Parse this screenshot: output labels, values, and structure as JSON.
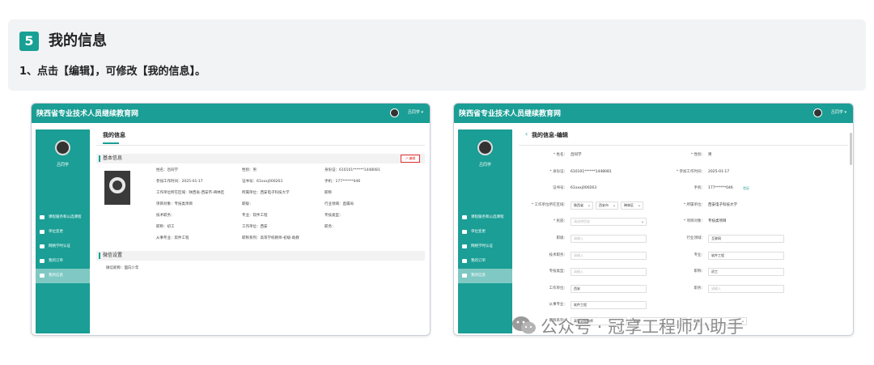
{
  "guide": {
    "step_number": "5",
    "step_title": "我的信息",
    "instruction": "1、点击【编辑】，可修改【我的信息】。"
  },
  "left_shot": {
    "site_title": "陕西省专业技术人员继续教育网",
    "user_name": "吕同学",
    "sidebar_user": "吕同学",
    "nav": [
      "课程服务和公选课程",
      "单位变更",
      "网络学时认证",
      "我的订单",
      "我的信息"
    ],
    "page_title": "我的信息",
    "section_basic": "基本信息",
    "edit_button": "编辑",
    "fields": {
      "name": "姓名：吕同学",
      "gender": "性别：男",
      "idcard": "身份证：610101******1448081",
      "workdate": "参加工作时间：2025-01-17",
      "cert": "证书号：61xxxj000263",
      "phone": "手机：177******046",
      "region": "工作单位所在区域：陕西省-西安市-碑林区",
      "unit": "所属单位：西安电子科技大学",
      "rank": "职称",
      "project": "项目对象：专技类项目",
      "post": "职级：",
      "industry": "行业领域：直属局",
      "tech_post": "技术职务：",
      "major": "专业：软件工程",
      "major_type": "专技类型：",
      "level": "职称：初工",
      "work_unit": "工作单位：西安",
      "duty": "职务：",
      "prof": "从事专业：软件工程",
      "series": "职称系列：高等学校教师-初级-助教"
    },
    "section_wx": "微信设置",
    "wx_label": "微信昵称：面向少年"
  },
  "right_shot": {
    "site_title": "陕西省专业技术人员继续教育网",
    "user_name": "吕同学",
    "sidebar_user": "吕同学",
    "nav": [
      "课程服务和公选课程",
      "单位变更",
      "网络学时认证",
      "我的订单",
      "我的信息"
    ],
    "page_title": "我的信息-编辑",
    "back_glyph": "‹",
    "labels": {
      "name": "* 姓名：",
      "gender": "* 性别：",
      "idcard": "* 身份证：",
      "workdate": "* 参加工作时间：",
      "cert": "证书号：",
      "phone": "手机：",
      "region": "* 工作单位所在区域：",
      "unit": "* 所属单位：",
      "nation": "* 民族：",
      "project": "* 项目对象：",
      "post": "职级：",
      "industry": "行业领域：",
      "tech": "技术职务：",
      "major": "专业：",
      "major_type": "专技类型：",
      "level": "职称：",
      "work_unit": "工作单位：",
      "duty": "职务：",
      "prof": "从事专业：",
      "series": "职称系列："
    },
    "values": {
      "name": "吕同学",
      "gender": "男",
      "idcard": "610101******1448081",
      "workdate": "2025-01-17",
      "cert": "61xxxj000263",
      "phone": "177******046",
      "verify": "验证",
      "prov": "陕西省",
      "city": "西安市",
      "dist": "碑林区",
      "unit": "西安电子科技大学",
      "nation_ph": "请选择民族",
      "project": "专技类项目",
      "post_ph": "请输入",
      "industry": "互联网",
      "tech_ph": "请输入",
      "major": "软件工程",
      "major_type_ph": "请输入",
      "level": "初工",
      "work_unit": "西安",
      "duty_ph": "请输入",
      "prof": "软件工程",
      "series1": "高等学校教师",
      "series2": "初级",
      "series3": "助教"
    }
  },
  "watermark": "公众号 · 冠享工程师小助手"
}
